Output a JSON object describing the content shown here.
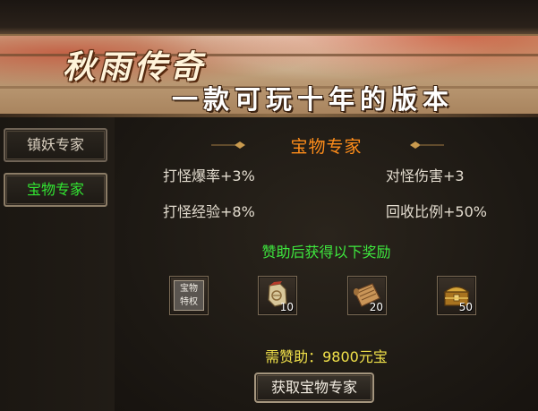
{
  "banner": {
    "title": "秋雨传奇",
    "slogan": "一款可玩十年的版本"
  },
  "side_menu": {
    "items": [
      {
        "label": "镇妖专家",
        "active": false
      },
      {
        "label": "宝物专家",
        "active": true
      }
    ]
  },
  "panel": {
    "title": "宝物专家",
    "stats": {
      "monster_drop": "打怪爆率+3%",
      "monster_damage": "对怪伤害+3",
      "monster_exp": "打怪经验+8%",
      "recycle_ratio": "回收比例+50%"
    },
    "reward_heading": "赞助后获得以下奖励",
    "rewards": [
      {
        "icon": "privilege-badge-icon",
        "badge_text": [
          "宝物",
          "特权"
        ],
        "count": ""
      },
      {
        "icon": "scroll-pouch-icon",
        "count": "10"
      },
      {
        "icon": "parchment-scroll-icon",
        "count": "20"
      },
      {
        "icon": "treasure-chest-icon",
        "count": "50"
      }
    ],
    "cost_label": "需赞助：9800元宝",
    "buy_button": "获取宝物专家"
  },
  "colors": {
    "accent_title": "#ff8d1a",
    "active_menu": "#32e532",
    "reward_heading": "#3ee83e",
    "cost": "#f2e24a"
  }
}
